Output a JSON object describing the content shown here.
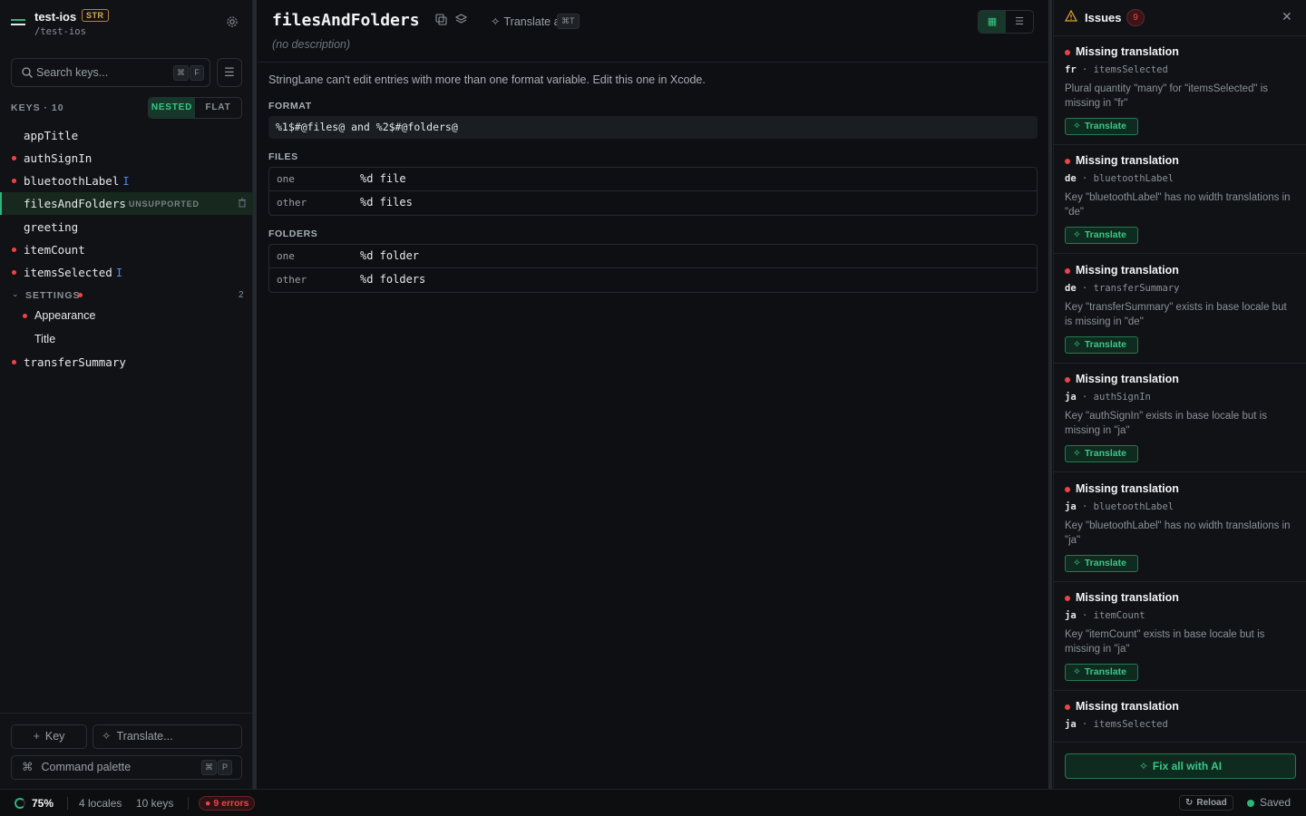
{
  "project": {
    "name": "test-ios",
    "badge": "STR",
    "path": "/test-ios"
  },
  "search": {
    "placeholder": "Search keys...",
    "kbd1": "⌘",
    "kbd2": "F"
  },
  "keys_header": {
    "label": "KEYS · 10",
    "nested": "NESTED",
    "flat": "FLAT"
  },
  "tree": [
    {
      "label": "appTitle",
      "dot": false
    },
    {
      "label": "authSignIn",
      "dot": true
    },
    {
      "label": "bluetoothLabel",
      "dot": true,
      "cursor": "I"
    },
    {
      "label": "filesAndFolders",
      "dot": false,
      "selected": true,
      "tag": "UNSUPPORTED"
    },
    {
      "label": "greeting",
      "dot": false
    },
    {
      "label": "itemCount",
      "dot": true
    },
    {
      "label": "itemsSelected",
      "dot": true,
      "cursor": "I"
    },
    {
      "label": "SETTINGS",
      "group": true,
      "dot": true,
      "count": "2"
    },
    {
      "label": "Appearance",
      "dot": true,
      "child": true
    },
    {
      "label": "Title",
      "dot": false,
      "child": true
    },
    {
      "label": "transferSummary",
      "dot": true
    }
  ],
  "footer": {
    "add_key": "Key",
    "translate": "Translate...",
    "palette": "Command palette",
    "palette_kbd1": "⌘",
    "palette_kbd2": "P"
  },
  "main": {
    "title": "filesAndFolders",
    "translate_all": "Translate all",
    "translate_all_kbd": "⌘T",
    "description": "(no description)",
    "notice": "StringLane can't edit entries with more than one format variable. Edit this one in Xcode.",
    "format_label": "FORMAT",
    "format_value": "%1$#@files@ and %2$#@folders@",
    "files_label": "FILES",
    "files": [
      {
        "q": "one",
        "v": "%d file"
      },
      {
        "q": "other",
        "v": "%d files"
      }
    ],
    "folders_label": "FOLDERS",
    "folders": [
      {
        "q": "one",
        "v": "%d folder"
      },
      {
        "q": "other",
        "v": "%d folders"
      }
    ]
  },
  "issues": {
    "title": "Issues",
    "count": "9",
    "button": "Translate",
    "fix_all": "Fix all with AI",
    "items": [
      {
        "title": "Missing translation",
        "locale": "fr",
        "key": "itemsSelected",
        "message": "Plural quantity \"many\" for \"itemsSelected\" is missing in \"fr\""
      },
      {
        "title": "Missing translation",
        "locale": "de",
        "key": "bluetoothLabel",
        "message": "Key \"bluetoothLabel\" has no width translations in \"de\""
      },
      {
        "title": "Missing translation",
        "locale": "de",
        "key": "transferSummary",
        "message": "Key \"transferSummary\" exists in base locale but is missing in \"de\""
      },
      {
        "title": "Missing translation",
        "locale": "ja",
        "key": "authSignIn",
        "message": "Key \"authSignIn\" exists in base locale but is missing in \"ja\""
      },
      {
        "title": "Missing translation",
        "locale": "ja",
        "key": "bluetoothLabel",
        "message": "Key \"bluetoothLabel\" has no width translations in \"ja\""
      },
      {
        "title": "Missing translation",
        "locale": "ja",
        "key": "itemCount",
        "message": "Key \"itemCount\" exists in base locale but is missing in \"ja\""
      },
      {
        "title": "Missing translation",
        "locale": "ja",
        "key": "itemsSelected",
        "message": ""
      }
    ]
  },
  "status": {
    "progress": "75%",
    "locales": "4 locales",
    "keys": "10 keys",
    "errors": "9 errors",
    "reload": "Reload",
    "saved": "Saved"
  },
  "colors": {
    "accent": "#2fb57a",
    "error": "#ef4444",
    "warning": "#d9a32a",
    "link": "#4e8cf0"
  }
}
